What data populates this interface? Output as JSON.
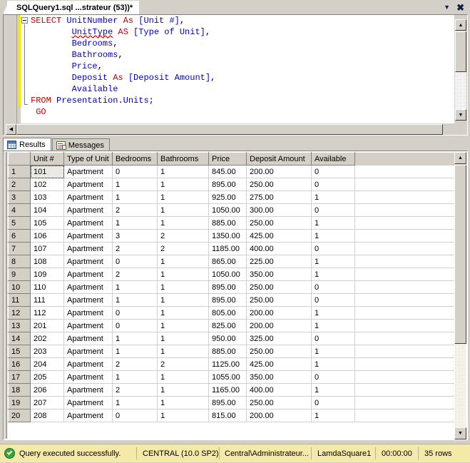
{
  "window": {
    "tab_title": "SQLQuery1.sql ...strateur (53))*",
    "dropdown_icon": "chevron-down-icon",
    "close_icon": "close-icon"
  },
  "editor": {
    "lines": [
      [
        {
          "t": "SELECT ",
          "c": "kw"
        },
        {
          "t": "UnitNumber",
          "c": "id"
        },
        {
          "t": " ",
          "c": "pl"
        },
        {
          "t": "As",
          "c": "kw"
        },
        {
          "t": " ",
          "c": "pl"
        },
        {
          "t": "[Unit #]",
          "c": "id"
        },
        {
          "t": ",",
          "c": "pl"
        }
      ],
      [
        {
          "t": "        ",
          "c": "pl"
        },
        {
          "t": "UnitType",
          "c": "id squiggle"
        },
        {
          "t": " ",
          "c": "pl"
        },
        {
          "t": "AS",
          "c": "kw"
        },
        {
          "t": " ",
          "c": "pl"
        },
        {
          "t": "[Type of Unit]",
          "c": "id"
        },
        {
          "t": ",",
          "c": "pl"
        }
      ],
      [
        {
          "t": "        ",
          "c": "pl"
        },
        {
          "t": "Bedrooms",
          "c": "id"
        },
        {
          "t": ",",
          "c": "pl"
        }
      ],
      [
        {
          "t": "        ",
          "c": "pl"
        },
        {
          "t": "Bathrooms",
          "c": "id"
        },
        {
          "t": ",",
          "c": "pl"
        }
      ],
      [
        {
          "t": "        ",
          "c": "pl"
        },
        {
          "t": "Price",
          "c": "id"
        },
        {
          "t": ",",
          "c": "pl"
        }
      ],
      [
        {
          "t": "        ",
          "c": "pl"
        },
        {
          "t": "Deposit",
          "c": "id"
        },
        {
          "t": " ",
          "c": "pl"
        },
        {
          "t": "As",
          "c": "kw"
        },
        {
          "t": " ",
          "c": "pl"
        },
        {
          "t": "[Deposit Amount]",
          "c": "id"
        },
        {
          "t": ",",
          "c": "pl"
        }
      ],
      [
        {
          "t": "        ",
          "c": "pl"
        },
        {
          "t": "Available",
          "c": "id"
        }
      ],
      [
        {
          "t": "FROM ",
          "c": "kw"
        },
        {
          "t": "Presentation",
          "c": "id"
        },
        {
          "t": ".",
          "c": "pl"
        },
        {
          "t": "Units",
          "c": "id"
        },
        {
          "t": ";",
          "c": "pl"
        }
      ],
      [
        {
          "t": " GO",
          "c": "kw"
        }
      ]
    ]
  },
  "results": {
    "tabs": [
      {
        "label": "Results",
        "icon": "grid-icon",
        "active": true
      },
      {
        "label": "Messages",
        "icon": "document-icon",
        "active": false
      }
    ],
    "columns": [
      "Unit #",
      "Type of Unit",
      "Bedrooms",
      "Bathrooms",
      "Price",
      "Deposit Amount",
      "Available"
    ],
    "rows": [
      {
        "n": "1",
        "cells": [
          "101",
          "Apartment",
          "0",
          "1",
          "845.00",
          "200.00",
          "0"
        ]
      },
      {
        "n": "2",
        "cells": [
          "102",
          "Apartment",
          "1",
          "1",
          "895.00",
          "250.00",
          "0"
        ]
      },
      {
        "n": "3",
        "cells": [
          "103",
          "Apartment",
          "1",
          "1",
          "925.00",
          "275.00",
          "1"
        ]
      },
      {
        "n": "4",
        "cells": [
          "104",
          "Apartment",
          "2",
          "1",
          "1050.00",
          "300.00",
          "0"
        ]
      },
      {
        "n": "5",
        "cells": [
          "105",
          "Apartment",
          "1",
          "1",
          "885.00",
          "250.00",
          "1"
        ]
      },
      {
        "n": "6",
        "cells": [
          "106",
          "Apartment",
          "3",
          "2",
          "1350.00",
          "425.00",
          "1"
        ]
      },
      {
        "n": "7",
        "cells": [
          "107",
          "Apartment",
          "2",
          "2",
          "1185.00",
          "400.00",
          "0"
        ]
      },
      {
        "n": "8",
        "cells": [
          "108",
          "Apartment",
          "0",
          "1",
          "865.00",
          "225.00",
          "1"
        ]
      },
      {
        "n": "9",
        "cells": [
          "109",
          "Apartment",
          "2",
          "1",
          "1050.00",
          "350.00",
          "1"
        ]
      },
      {
        "n": "10",
        "cells": [
          "110",
          "Apartment",
          "1",
          "1",
          "895.00",
          "250.00",
          "0"
        ]
      },
      {
        "n": "11",
        "cells": [
          "111",
          "Apartment",
          "1",
          "1",
          "895.00",
          "250.00",
          "0"
        ]
      },
      {
        "n": "12",
        "cells": [
          "112",
          "Apartment",
          "0",
          "1",
          "805.00",
          "200.00",
          "1"
        ]
      },
      {
        "n": "13",
        "cells": [
          "201",
          "Apartment",
          "0",
          "1",
          "825.00",
          "200.00",
          "1"
        ]
      },
      {
        "n": "14",
        "cells": [
          "202",
          "Apartment",
          "1",
          "1",
          "950.00",
          "325.00",
          "0"
        ]
      },
      {
        "n": "15",
        "cells": [
          "203",
          "Apartment",
          "1",
          "1",
          "885.00",
          "250.00",
          "1"
        ]
      },
      {
        "n": "16",
        "cells": [
          "204",
          "Apartment",
          "2",
          "2",
          "1125.00",
          "425.00",
          "1"
        ]
      },
      {
        "n": "17",
        "cells": [
          "205",
          "Apartment",
          "1",
          "1",
          "1055.00",
          "350.00",
          "0"
        ]
      },
      {
        "n": "18",
        "cells": [
          "206",
          "Apartment",
          "2",
          "1",
          "1165.00",
          "400.00",
          "1"
        ]
      },
      {
        "n": "19",
        "cells": [
          "207",
          "Apartment",
          "1",
          "1",
          "895.00",
          "250.00",
          "0"
        ]
      },
      {
        "n": "20",
        "cells": [
          "208",
          "Apartment",
          "0",
          "1",
          "815.00",
          "200.00",
          "1"
        ]
      }
    ]
  },
  "statusbar": {
    "status_icon": "success-check-icon",
    "message": "Query executed successfully.",
    "server": "CENTRAL (10.0 SP2)",
    "user": "Central\\Administrateur...",
    "database": "LamdaSquare1",
    "elapsed": "00:00:00",
    "row_count": "35 rows"
  }
}
